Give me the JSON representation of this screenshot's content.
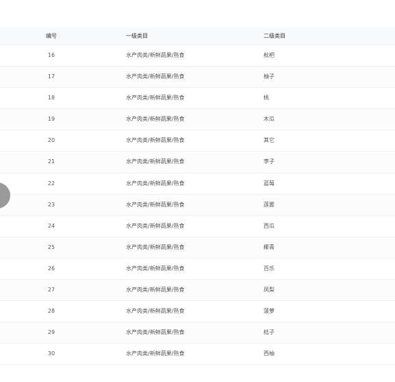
{
  "table": {
    "headers": {
      "id": "编号",
      "level1": "一级类目",
      "level2": "二级类目"
    },
    "rows": [
      {
        "id": "16",
        "level1": "水产肉类/新鲜蔬果/熟食",
        "level2": "枇杷"
      },
      {
        "id": "17",
        "level1": "水产肉类/新鲜蔬果/熟食",
        "level2": "柚子"
      },
      {
        "id": "18",
        "level1": "水产肉类/新鲜蔬果/熟食",
        "level2": "桃"
      },
      {
        "id": "19",
        "level1": "水产肉类/新鲜蔬果/熟食",
        "level2": "木瓜"
      },
      {
        "id": "20",
        "level1": "水产肉类/新鲜蔬果/熟食",
        "level2": "其它"
      },
      {
        "id": "21",
        "level1": "水产肉类/新鲜蔬果/熟食",
        "level2": "李子"
      },
      {
        "id": "22",
        "level1": "水产肉类/新鲜蔬果/熟食",
        "level2": "蓝莓"
      },
      {
        "id": "23",
        "level1": "水产肉类/新鲜蔬果/熟食",
        "level2": "莲雾"
      },
      {
        "id": "24",
        "level1": "水产肉类/新鲜蔬果/熟食",
        "level2": "西瓜"
      },
      {
        "id": "25",
        "level1": "水产肉类/新鲜蔬果/熟食",
        "level2": "椰青"
      },
      {
        "id": "26",
        "level1": "水产肉类/新鲜蔬果/熟食",
        "level2": "百乐"
      },
      {
        "id": "27",
        "level1": "水产肉类/新鲜蔬果/熟食",
        "level2": "凤梨"
      },
      {
        "id": "28",
        "level1": "水产肉类/新鲜蔬果/熟食",
        "level2": "菠萝"
      },
      {
        "id": "29",
        "level1": "水产肉类/新鲜蔬果/熟食",
        "level2": "桔子"
      },
      {
        "id": "30",
        "level1": "水产肉类/新鲜蔬果/熟食",
        "level2": "西柚"
      }
    ]
  }
}
